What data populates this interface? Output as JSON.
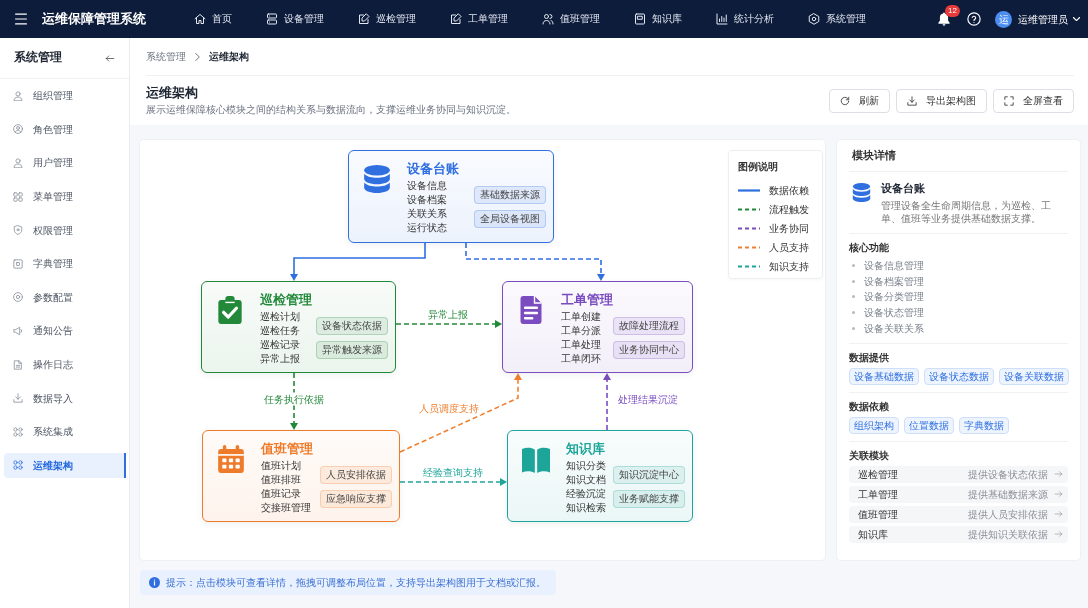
{
  "navbar": {
    "title": "运维保障管理系统",
    "items": [
      {
        "label": "首页",
        "selected": false
      },
      {
        "label": "设备管理",
        "selected": false
      },
      {
        "label": "巡检管理",
        "selected": false
      },
      {
        "label": "工单管理",
        "selected": false
      },
      {
        "label": "值班管理",
        "selected": false
      },
      {
        "label": "知识库",
        "selected": false
      },
      {
        "label": "统计分析",
        "selected": false
      },
      {
        "label": "系统管理",
        "selected": false
      }
    ],
    "notification_count": "12",
    "user": {
      "avatar": "运",
      "name": "运维管理员"
    }
  },
  "sidebar": {
    "title": "系统管理",
    "items": [
      {
        "label": "组织管理",
        "selected": false
      },
      {
        "label": "角色管理",
        "selected": false
      },
      {
        "label": "用户管理",
        "selected": false
      },
      {
        "label": "菜单管理",
        "selected": false
      },
      {
        "label": "权限管理",
        "selected": false
      },
      {
        "label": "字典管理",
        "selected": false
      },
      {
        "label": "参数配置",
        "selected": false
      },
      {
        "label": "通知公告",
        "selected": false
      },
      {
        "label": "操作日志",
        "selected": false
      },
      {
        "label": "数据导入",
        "selected": false
      },
      {
        "label": "系统集成",
        "selected": false
      },
      {
        "label": "运维架构",
        "selected": true
      }
    ]
  },
  "breadcrumb": [
    "系统管理",
    "运维架构"
  ],
  "page_header": {
    "title": "运维架构",
    "subtitle": "展示运维保障核心模块之间的结构关系与数据流向，支撑运维业务协同与知识沉淀。",
    "buttons": [
      "刷新",
      "导出架构图",
      "全屏查看"
    ]
  },
  "diagram": {
    "nodes": [
      {
        "title": "设备台账",
        "color": "#2f6fe0",
        "items": [
          "设备信息",
          "设备档案",
          "关联关系",
          "运行状态"
        ],
        "tags": [
          "基础数据来源",
          "全局设备视图"
        ]
      },
      {
        "title": "巡检管理",
        "color": "#23893a",
        "items": [
          "巡检计划",
          "巡检任务",
          "巡检记录",
          "异常上报"
        ],
        "tags": [
          "设备状态依据",
          "异常触发来源"
        ]
      },
      {
        "title": "工单管理",
        "color": "#7a4cc0",
        "items": [
          "工单创建",
          "工单分派",
          "工单处理",
          "工单闭环"
        ],
        "tags": [
          "故障处理流程",
          "业务协同中心"
        ]
      },
      {
        "title": "值班管理",
        "color": "#ee7b2a",
        "items": [
          "值班计划",
          "值班排班",
          "值班记录",
          "交接班管理"
        ],
        "tags": [
          "人员安排依据",
          "应急响应支撑"
        ]
      },
      {
        "title": "知识库",
        "color": "#1ea59a",
        "items": [
          "知识分类",
          "知识文档",
          "经验沉淀",
          "知识检索"
        ],
        "tags": [
          "知识沉淀中心",
          "业务赋能支撑"
        ]
      }
    ],
    "edges": [
      {
        "kind": "solid",
        "color": "#2f6fe0"
      },
      {
        "kind": "dashed",
        "color": "#2f6fe0"
      },
      {
        "kind": "dashed",
        "color": "#23893a",
        "label": "异常上报"
      },
      {
        "kind": "dashed",
        "color": "#23893a",
        "label": "任务执行依据"
      },
      {
        "kind": "dashed",
        "color": "#f08030",
        "label": "人员调度支持"
      },
      {
        "kind": "dashed",
        "color": "#1ea59a",
        "label": "经验查询支持"
      },
      {
        "kind": "dashed",
        "color": "#7a4cc0",
        "label": "处理结果沉淀"
      }
    ],
    "legend": {
      "title": "图例说明",
      "items": [
        {
          "label": "数据依赖",
          "kind": "solid",
          "color": "#2f6fe0"
        },
        {
          "label": "流程触发",
          "kind": "dashed",
          "color": "#23893a"
        },
        {
          "label": "业务协同",
          "kind": "dashed",
          "color": "#7a4cc0"
        },
        {
          "label": "人员支持",
          "kind": "dashed",
          "color": "#f08030"
        },
        {
          "label": "知识支持",
          "kind": "dashed",
          "color": "#1ea59a"
        }
      ]
    }
  },
  "details": {
    "header": "模块详情",
    "module": {
      "title": "设备台账",
      "description": "管理设备全生命周期信息，为巡检、工单、值班等业务提供基础数据支撑。"
    },
    "core_functions": {
      "heading": "核心功能",
      "items": [
        "设备信息管理",
        "设备档案管理",
        "设备分类管理",
        "设备状态管理",
        "设备关联关系"
      ]
    },
    "data_provided": {
      "heading": "数据提供",
      "tags": [
        "设备基础数据",
        "设备状态数据",
        "设备关联数据"
      ]
    },
    "data_dependencies": {
      "heading": "数据依赖",
      "tags": [
        "组织架构",
        "位置数据",
        "字典数据"
      ]
    },
    "related_modules": {
      "heading": "关联模块",
      "items": [
        {
          "name": "巡检管理",
          "relation": "提供设备状态依据"
        },
        {
          "name": "工单管理",
          "relation": "提供基础数据来源"
        },
        {
          "name": "值班管理",
          "relation": "提供人员安排依据"
        },
        {
          "name": "知识库",
          "relation": "提供知识关联依据"
        }
      ]
    }
  },
  "hint": "提示：点击模块可查看详情，拖拽可调整布局位置，支持导出架构图用于文档或汇报。"
}
